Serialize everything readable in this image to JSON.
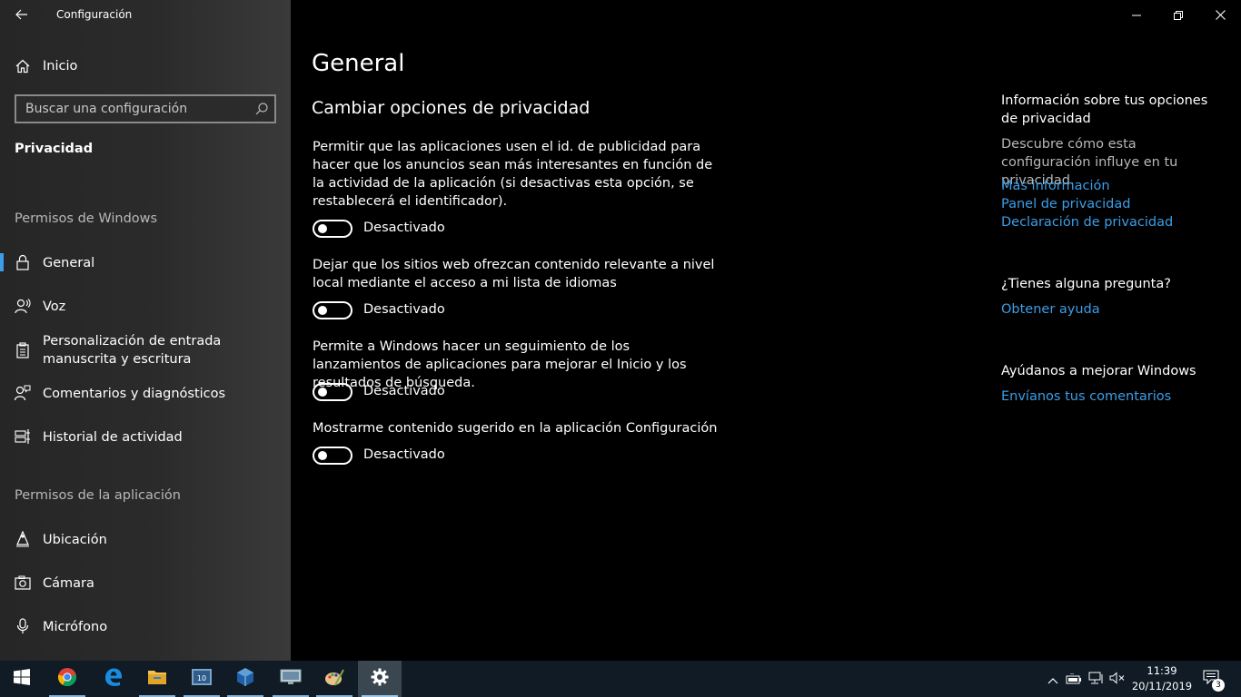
{
  "window": {
    "title": "Configuración"
  },
  "sidebar": {
    "home_label": "Inicio",
    "search_placeholder": "Buscar una configuración",
    "category": "Privacidad",
    "section1_title": "Permisos de Windows",
    "section1_items": [
      {
        "label": "General",
        "icon": "lock-icon",
        "selected": true
      },
      {
        "label": "Voz",
        "icon": "speech-icon"
      },
      {
        "label": "Personalización de entrada manuscrita y escritura",
        "icon": "clipboard-icon"
      },
      {
        "label": "Comentarios y diagnósticos",
        "icon": "feedback-icon"
      },
      {
        "label": "Historial de actividad",
        "icon": "timeline-icon"
      }
    ],
    "section2_title": "Permisos de la aplicación",
    "section2_items": [
      {
        "label": "Ubicación",
        "icon": "location-icon"
      },
      {
        "label": "Cámara",
        "icon": "camera-icon"
      },
      {
        "label": "Micrófono",
        "icon": "microphone-icon"
      }
    ]
  },
  "main": {
    "title": "General",
    "subtitle": "Cambiar opciones de privacidad",
    "options": [
      {
        "description": "Permitir que las aplicaciones usen el id. de publicidad para hacer que los anuncios sean más interesantes en función de la actividad de la aplicación (si desactivas esta opción, se restablecerá el identificador).",
        "state": "Desactivado",
        "on": false
      },
      {
        "description": "Dejar que los sitios web ofrezcan contenido relevante a nivel local mediante el acceso a mi lista de idiomas",
        "state": "Desactivado",
        "on": false
      },
      {
        "description": "Permite a Windows hacer un seguimiento de los lanzamientos de aplicaciones para mejorar el Inicio y los resultados de búsqueda.",
        "state": "Desactivado",
        "on": false
      },
      {
        "description": "Mostrarme contenido sugerido en la aplicación Configuración",
        "state": "Desactivado",
        "on": false
      }
    ]
  },
  "right_panel": {
    "info_heading": "Información sobre tus opciones de privacidad",
    "info_text": "Descubre cómo esta configuración influye en tu privacidad.",
    "info_links": [
      "Más información",
      "Panel de privacidad",
      "Declaración de privacidad"
    ],
    "question_heading": "¿Tienes alguna pregunta?",
    "question_link": "Obtener ayuda",
    "improve_heading": "Ayúdanos a mejorar Windows",
    "improve_link": "Envíanos tus comentarios"
  },
  "taskbar": {
    "apps": [
      "start-icon",
      "chrome-icon",
      "edge-icon",
      "file-explorer-icon",
      "cpu-z-icon",
      "virtualbox-icon",
      "remote-desktop-icon",
      "paint-icon",
      "settings-icon"
    ],
    "clock_time": "11:39",
    "clock_date": "20/11/2019",
    "notification_count": "3"
  },
  "colors": {
    "accent": "#3c9ee8",
    "taskbar": "#101b26",
    "background": "#000000"
  }
}
